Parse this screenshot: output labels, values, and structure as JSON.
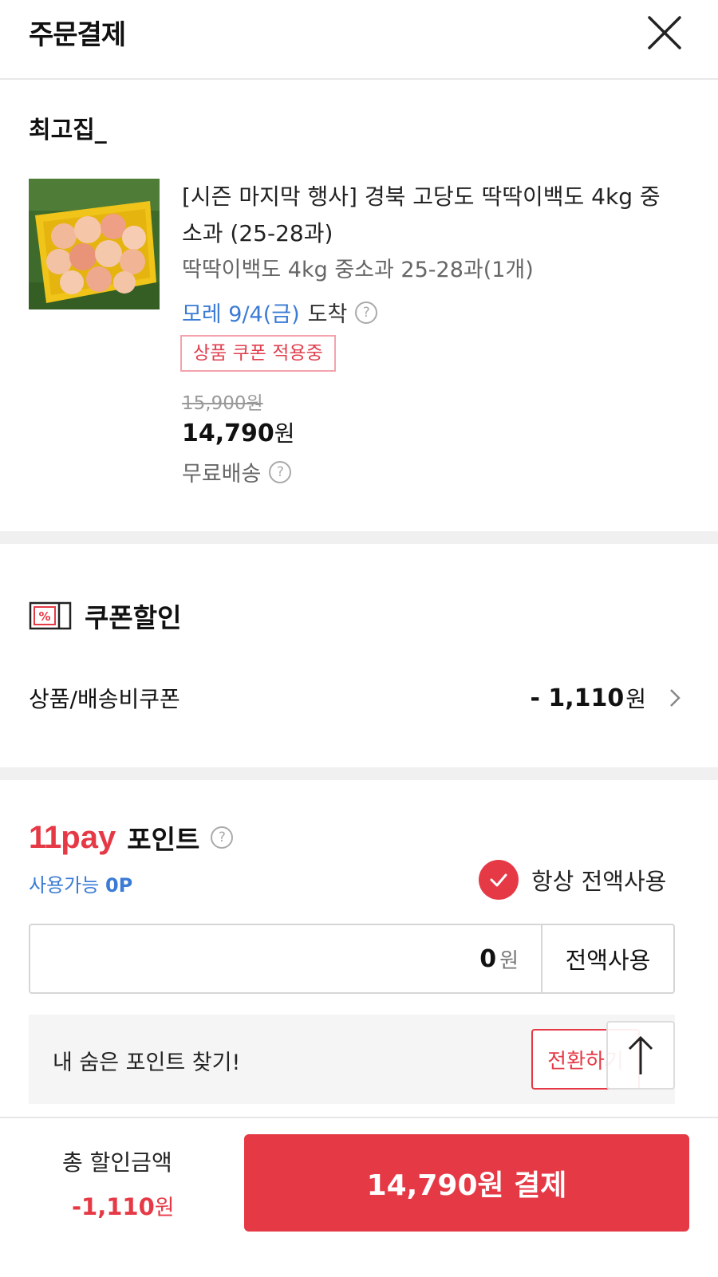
{
  "header": {
    "title": "주문결제",
    "close_icon": "close-icon"
  },
  "seller": {
    "name": "최고집_"
  },
  "product": {
    "name": "[시즌 마지막 행사] 경북 고당도 딱딱이백도 4kg 중소과 (25-28과)",
    "option": "딱딱이백도 4kg 중소과 25-28과(1개)",
    "delivery_date": "모레 9/4(금)",
    "delivery_suffix": "도착",
    "coupon_badge": "상품 쿠폰 적용중",
    "original_price": "15,900원",
    "price_number": "14,790",
    "price_unit": "원",
    "shipping": "무료배송",
    "help_mark": "?"
  },
  "coupon": {
    "title": "쿠폰할인",
    "icon_symbol": "%",
    "row_label": "상품/배송비쿠폰",
    "row_value": "- 1,110",
    "row_unit": "원"
  },
  "points": {
    "brand_11": "11",
    "brand_pay": "pay",
    "title": "포인트",
    "available_label": "사용가능",
    "available_value": "0P",
    "always_use_label": "항상 전액사용",
    "always_use_checked": true,
    "input_value": "0",
    "input_unit": "원",
    "use_all_button": "전액사용",
    "hidden_points_text": "내 숨은 포인트 찾기!",
    "convert_button": "전환하기"
  },
  "footer": {
    "total_discount_label": "총 할인금액",
    "total_discount_value": "-1,110",
    "total_discount_unit": "원",
    "pay_button": "14,790원 결제"
  },
  "colors": {
    "accent": "#e63946",
    "link_blue": "#3a7bd5",
    "gray_text": "#666666"
  }
}
